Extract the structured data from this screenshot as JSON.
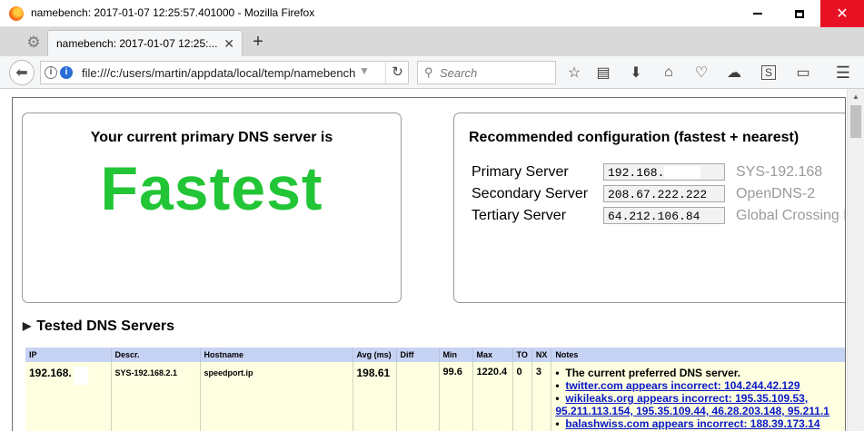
{
  "window": {
    "title": "namebench: 2017-01-07 12:25:57.401000 - Mozilla Firefox",
    "minimize_glyph": "",
    "close_glyph": "✕"
  },
  "tabs": [
    {
      "label": "namebench: 2017-01-07 12:25:...",
      "close": "✕"
    }
  ],
  "newtab_glyph": "+",
  "navbar": {
    "url": "file:///c:/users/martin/appdata/local/temp/namebench",
    "search_placeholder": "Search",
    "icons": [
      "bookmark-star-icon",
      "reader-list-icon",
      "download-icon",
      "home-icon",
      "pocket-icon",
      "sync-icon",
      "s-addon-icon",
      "screenshot-icon",
      "menu-icon"
    ]
  },
  "current": {
    "heading": "Your current primary DNS server is",
    "verdict": "Fastest",
    "verdict_color": "#22c535"
  },
  "recommended": {
    "heading": "Recommended configuration (fastest + nearest)",
    "rows": [
      {
        "label": "Primary Server",
        "ip": "192.168.",
        "desc": "SYS-192.168"
      },
      {
        "label": "Secondary Server",
        "ip": "208.67.222.222",
        "desc": "OpenDNS-2"
      },
      {
        "label": "Tertiary Server",
        "ip": "64.212.106.84",
        "desc": "Global Crossing N"
      }
    ]
  },
  "tested": {
    "title": "Tested DNS Servers",
    "columns": [
      "IP",
      "Descr.",
      "Hostname",
      "Avg (ms)",
      "Diff",
      "Min",
      "Max",
      "TO",
      "NX",
      "Notes"
    ],
    "rows": [
      {
        "ip": "192.168.",
        "descr": "SYS-192.168.2.1",
        "hostname": "speedport.ip",
        "avg": "198.61",
        "diff": "",
        "min": "99.6",
        "max": "1220.4",
        "to": "0",
        "nx": "3",
        "notes": [
          {
            "text": "The current preferred DNS server.",
            "link": false
          },
          {
            "text": "twitter.com appears incorrect: 104.244.42.129",
            "link": true
          },
          {
            "text": "wikileaks.org appears incorrect: 195.35.109.53,",
            "link": true
          },
          {
            "text": "95.211.113.154, 195.35.109.44, 46.28.203.148, 95.211.1",
            "link": true,
            "continuation": true
          },
          {
            "text": "balashwiss.com appears incorrect: 188.39.173.14",
            "link": true
          }
        ]
      }
    ]
  },
  "colors": {
    "header_row": "#c7d3f4",
    "row_bg": "#fdffe0",
    "link": "#0a18c7",
    "close_button": "#e81123"
  }
}
